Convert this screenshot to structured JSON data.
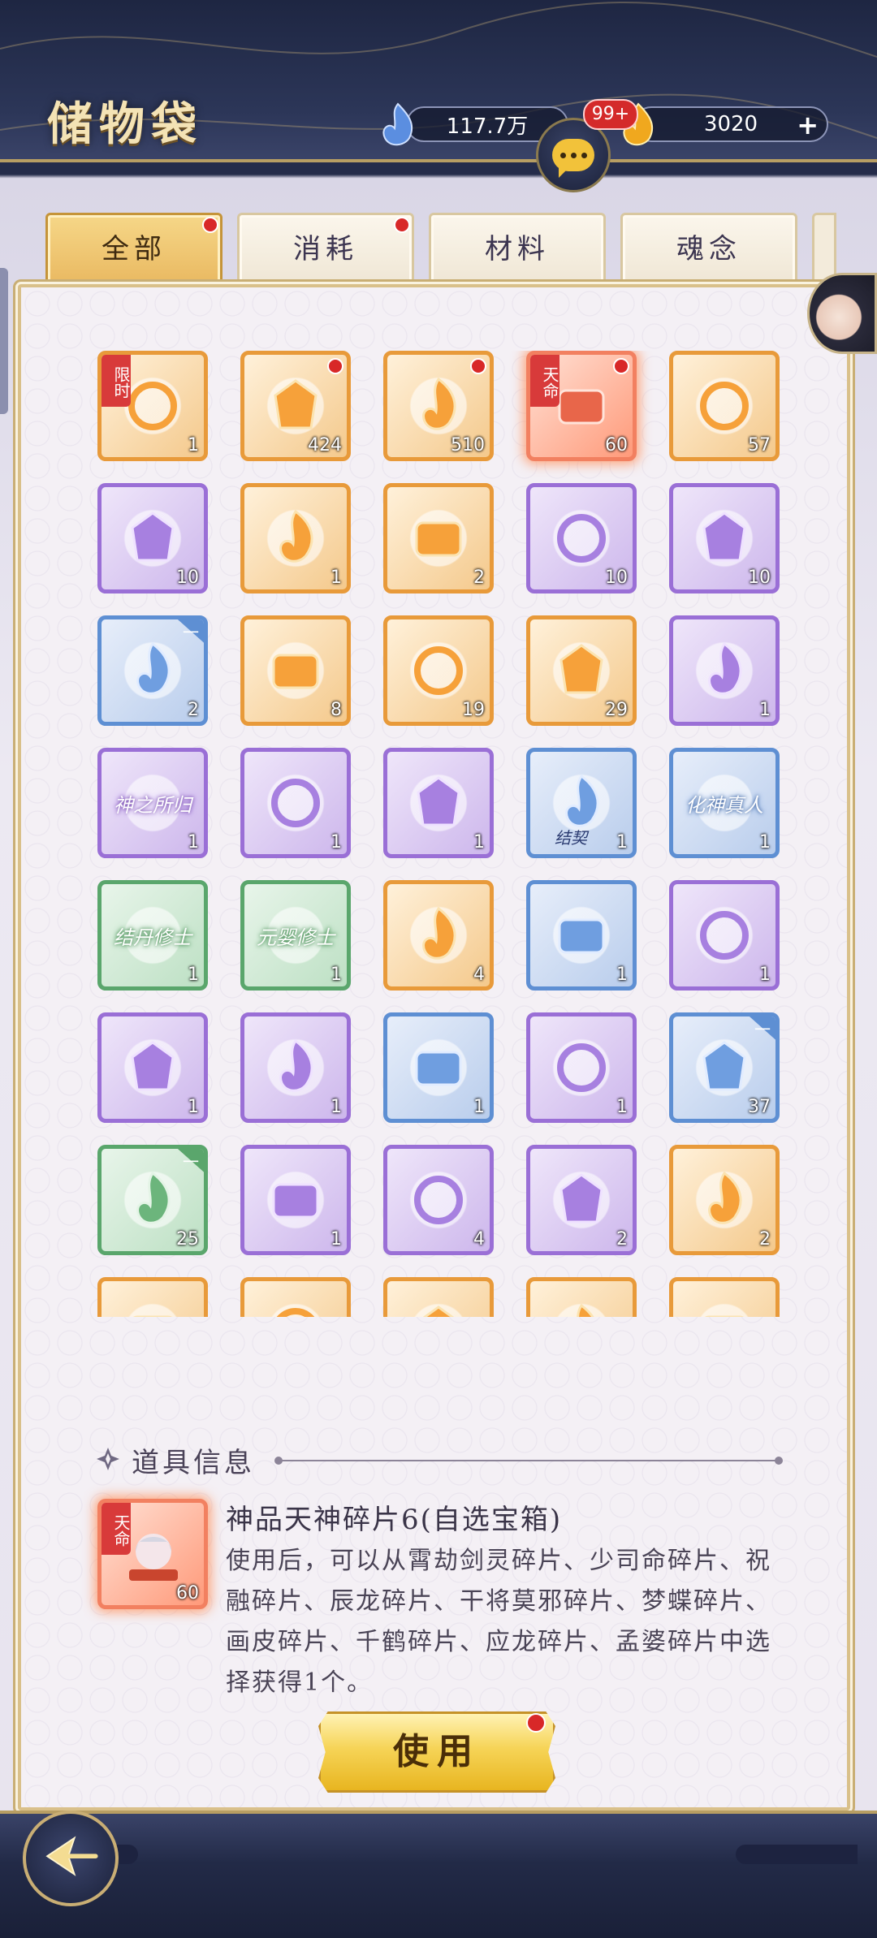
{
  "header": {
    "title": "储物袋",
    "currency_a": {
      "value": "117.7万",
      "icon": "blue-flame-icon"
    },
    "currency_b": {
      "value": "3020",
      "icon": "gold-flame-icon",
      "add_label": "+"
    },
    "chat_badge": "99+",
    "chat_icon": "chat-bubble-icon"
  },
  "tabs": [
    {
      "label": "全部",
      "active": true,
      "dot": true
    },
    {
      "label": "消耗",
      "active": false,
      "dot": true
    },
    {
      "label": "材料",
      "active": false,
      "dot": false
    },
    {
      "label": "魂念",
      "active": false,
      "dot": false
    }
  ],
  "grid": {
    "items": [
      {
        "quality": "orange",
        "count": "1",
        "tag": "限时",
        "icon": "scroll-icon"
      },
      {
        "quality": "orange",
        "count": "424",
        "dot": true,
        "icon": "dragon-token-icon"
      },
      {
        "quality": "orange",
        "count": "510",
        "dot": true,
        "icon": "orb-token-icon"
      },
      {
        "quality": "red",
        "count": "60",
        "dot": true,
        "tag": "天命",
        "icon": "hero-portrait-icon"
      },
      {
        "quality": "orange",
        "count": "57",
        "icon": "golden-flame-icon"
      },
      {
        "quality": "purple",
        "count": "10",
        "icon": "purple-spirit-icon"
      },
      {
        "quality": "orange",
        "count": "1",
        "icon": "ornate-chest-icon"
      },
      {
        "quality": "orange",
        "count": "2",
        "icon": "water-spirit-icon"
      },
      {
        "quality": "purple",
        "count": "10",
        "icon": "purple-chest-icon"
      },
      {
        "quality": "purple",
        "count": "10",
        "icon": "purple-chest-icon"
      },
      {
        "quality": "blue",
        "count": "2",
        "corner": "一",
        "icon": "porcelain-bottle-icon"
      },
      {
        "quality": "orange",
        "count": "8",
        "icon": "hero-chest-icon"
      },
      {
        "quality": "orange",
        "count": "19",
        "icon": "fire-sword-icon"
      },
      {
        "quality": "orange",
        "count": "29",
        "icon": "ice-sword-icon"
      },
      {
        "quality": "purple",
        "count": "1",
        "icon": "talisman-icon"
      },
      {
        "quality": "purple",
        "count": "1",
        "script": "神之所归",
        "icon": "title-icon"
      },
      {
        "quality": "purple",
        "count": "1",
        "icon": "ring-frame-icon"
      },
      {
        "quality": "purple",
        "count": "1",
        "icon": "lightning-ring-icon"
      },
      {
        "quality": "blue",
        "count": "1",
        "script_small": "结契",
        "icon": "dark-ring-icon"
      },
      {
        "quality": "blue",
        "count": "1",
        "script": "化神真人",
        "icon": "title-icon"
      },
      {
        "quality": "green",
        "count": "1",
        "script": "结丹修士",
        "icon": "title-icon"
      },
      {
        "quality": "green",
        "count": "1",
        "script": "元婴修士",
        "icon": "title-icon"
      },
      {
        "quality": "orange",
        "count": "4",
        "icon": "red-scroll-icon"
      },
      {
        "quality": "blue",
        "count": "1",
        "icon": "blue-scroll-icon"
      },
      {
        "quality": "purple",
        "count": "1",
        "icon": "flower-pouch-icon"
      },
      {
        "quality": "purple",
        "count": "1",
        "icon": "jewel-box-icon"
      },
      {
        "quality": "purple",
        "count": "1",
        "icon": "jewel-box-icon"
      },
      {
        "quality": "blue",
        "count": "1",
        "icon": "jade-ring-icon"
      },
      {
        "quality": "purple",
        "count": "1",
        "icon": "fire-ring-icon"
      },
      {
        "quality": "blue",
        "count": "37",
        "corner": "一",
        "icon": "blue-vase-icon"
      },
      {
        "quality": "green",
        "count": "25",
        "corner": "一",
        "icon": "green-vase-icon"
      },
      {
        "quality": "purple",
        "count": "1",
        "icon": "spirit-pot-icon"
      },
      {
        "quality": "purple",
        "count": "4",
        "icon": "spirit-pot-icon"
      },
      {
        "quality": "purple",
        "count": "2",
        "icon": "spirit-pot-icon"
      },
      {
        "quality": "orange",
        "count": "2",
        "icon": "red-charm-icon"
      },
      {
        "quality": "orange",
        "count": "",
        "icon": "partial-item-icon"
      },
      {
        "quality": "orange",
        "count": "",
        "icon": "partial-item-icon"
      },
      {
        "quality": "orange",
        "count": "",
        "icon": "partial-item-icon"
      },
      {
        "quality": "orange",
        "count": "",
        "icon": "partial-item-icon"
      },
      {
        "quality": "orange",
        "count": "",
        "icon": "partial-item-icon"
      }
    ]
  },
  "info": {
    "section_title": "道具信息",
    "selected": {
      "tag": "天命",
      "count": "60"
    },
    "name": "神品天神碎片6(自选宝箱)",
    "description": "使用后，可以从霄劫剑灵碎片、少司命碎片、祝融碎片、辰龙碎片、干将莫邪碎片、梦蝶碎片、画皮碎片、千鹤碎片、应龙碎片、孟婆碎片中选择获得1个。",
    "use_label": "使用"
  },
  "colors": {
    "orange": "#e89a3a",
    "purple": "#9a6fd6",
    "blue": "#5e8fd3",
    "green": "#5aa66c",
    "red": "#f28060",
    "accent_gold": "#c9ae74"
  }
}
